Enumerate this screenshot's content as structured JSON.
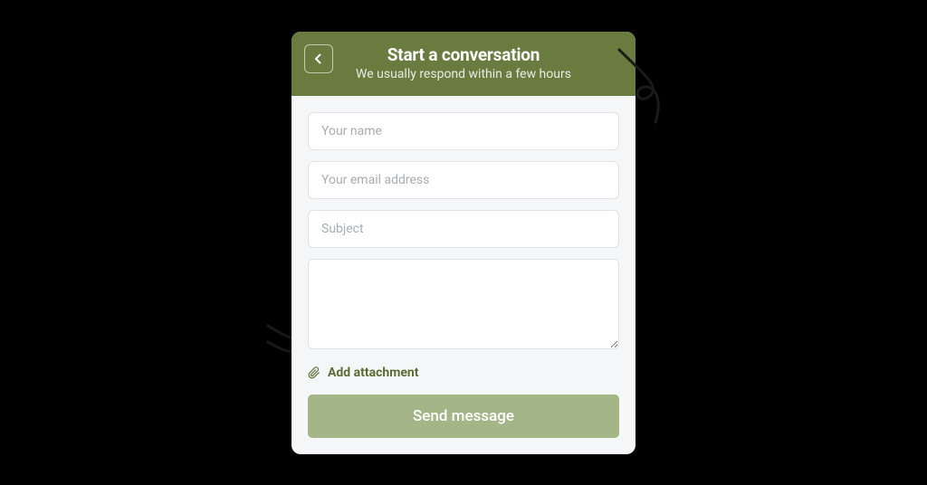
{
  "header": {
    "title": "Start a conversation",
    "subtitle": "We usually respond within a few hours"
  },
  "form": {
    "name_placeholder": "Your name",
    "email_placeholder": "Your email address",
    "subject_placeholder": "Subject",
    "message_placeholder": ""
  },
  "attachment": {
    "label": "Add attachment"
  },
  "actions": {
    "send_label": "Send message"
  },
  "colors": {
    "header_bg": "#6a7b3f",
    "accent_text": "#5c6b34",
    "send_bg": "#a4b588"
  }
}
